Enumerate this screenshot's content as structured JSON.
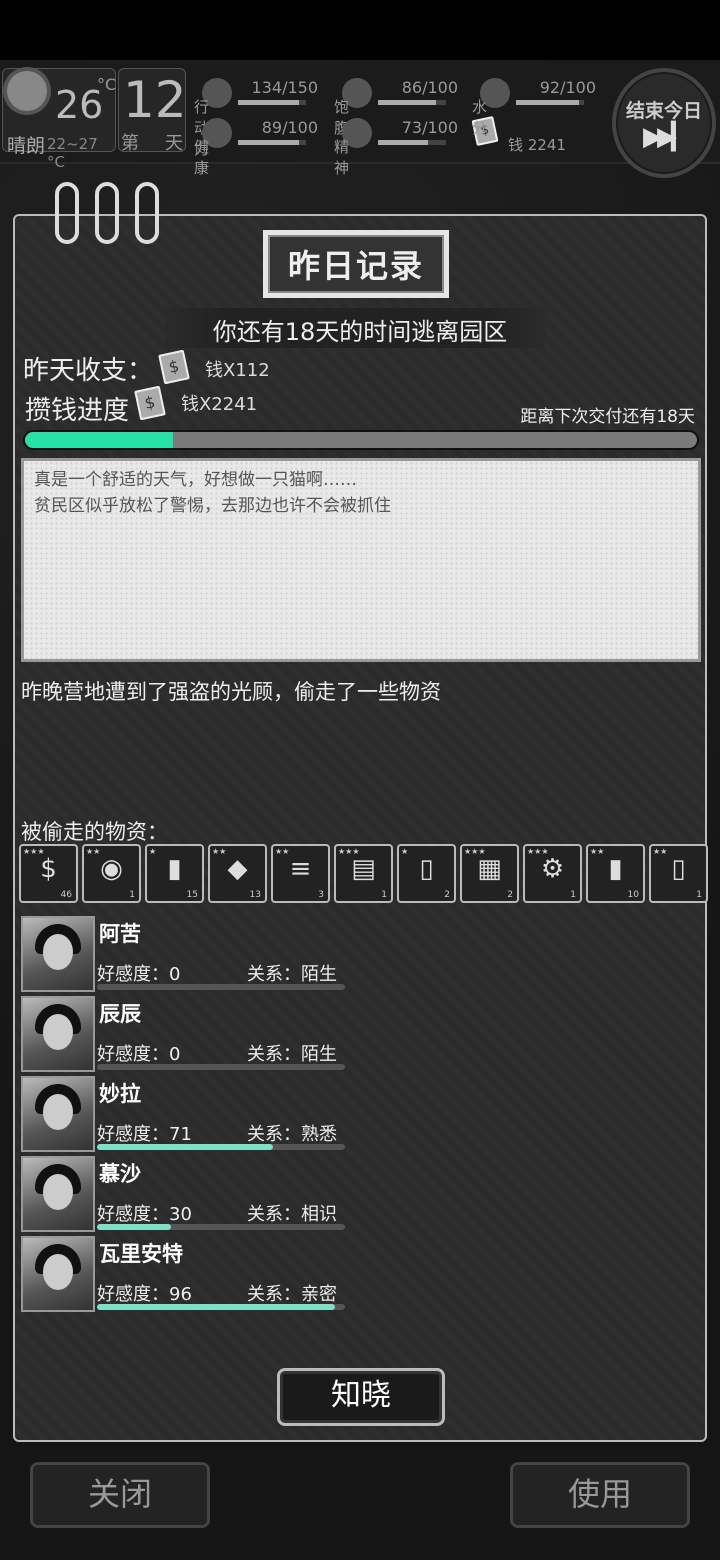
{
  "status": {
    "weather_temp": "26",
    "weather_unit": "°C",
    "weather_label": "晴朗",
    "temp_range": "22~27 °C",
    "day_number": "12",
    "day_prefix": "第",
    "day_suffix": "天",
    "end_day_label": "结束今日",
    "end_day_icon": "fast-forward-icon",
    "stats": [
      {
        "label": "行动力",
        "value": "134/150",
        "fraction": 0.893
      },
      {
        "label": "饱腹",
        "value": "86/100",
        "fraction": 0.86
      },
      {
        "label": "水分",
        "value": "92/100",
        "fraction": 0.92
      },
      {
        "label": "健康",
        "value": "89/100",
        "fraction": 0.89
      },
      {
        "label": "精神",
        "value": "73/100",
        "fraction": 0.73
      }
    ],
    "money_label": "钱 2241"
  },
  "dialog": {
    "title": "昨日记录",
    "countdown": "你还有18天的时间逃离园区",
    "income_label": "昨天收支：",
    "income_value": "钱X112",
    "savings_label": "攒钱进度",
    "savings_value": "钱X2241",
    "deliver_note": "距离下次交付还有18天",
    "progress_fraction": 0.22,
    "note_lines": [
      "真是一个舒适的天气，好想做一只猫啊……",
      "贫民区似乎放松了警惕，去那边也许不会被抓住"
    ],
    "event_text": "昨晚营地遭到了强盗的光顾，偷走了一些物资",
    "stolen_label": "被偷走的物资：",
    "items": [
      {
        "icon": "cash-stack-icon",
        "glyph": "$",
        "count": "46",
        "stars": "★★★"
      },
      {
        "icon": "bowl-icon",
        "glyph": "◉",
        "count": "1",
        "stars": "★★"
      },
      {
        "icon": "can-icon",
        "glyph": "▮",
        "count": "15",
        "stars": "★"
      },
      {
        "icon": "rock-icon",
        "glyph": "◆",
        "count": "13",
        "stars": "★★"
      },
      {
        "icon": "pipe-icon",
        "glyph": "≡",
        "count": "3",
        "stars": "★★"
      },
      {
        "icon": "ticket-icon",
        "glyph": "▤",
        "count": "1",
        "stars": "★★★"
      },
      {
        "icon": "bottle-icon",
        "glyph": "▯",
        "count": "2",
        "stars": "★"
      },
      {
        "icon": "food-box-icon",
        "glyph": "▦",
        "count": "2",
        "stars": "★★★"
      },
      {
        "icon": "bicycle-icon",
        "glyph": "⚙",
        "count": "1",
        "stars": "★★★"
      },
      {
        "icon": "soda-can-icon",
        "glyph": "▮",
        "count": "10",
        "stars": "★★"
      },
      {
        "icon": "water-bottle-icon",
        "glyph": "▯",
        "count": "1",
        "stars": "★★"
      },
      {
        "icon": "item-icon",
        "glyph": "",
        "count": "",
        "stars": ""
      }
    ],
    "characters": [
      {
        "name": "阿苦",
        "affection_label": "好感度：0",
        "relation_label": "关系：陌生",
        "affection": 0
      },
      {
        "name": "辰辰",
        "affection_label": "好感度：0",
        "relation_label": "关系：陌生",
        "affection": 0
      },
      {
        "name": "妙拉",
        "affection_label": "好感度：71",
        "relation_label": "关系：熟悉",
        "affection": 71
      },
      {
        "name": "慕沙",
        "affection_label": "好感度：30",
        "relation_label": "关系：相识",
        "affection": 30
      },
      {
        "name": "瓦里安特",
        "affection_label": "好感度：96",
        "relation_label": "关系：亲密",
        "affection": 96
      }
    ],
    "ack_label": "知晓"
  },
  "footer": {
    "close_label": "关闭",
    "use_label": "使用"
  },
  "colors": {
    "progress": "#27e0a6",
    "affection": "#7fe0c8"
  }
}
